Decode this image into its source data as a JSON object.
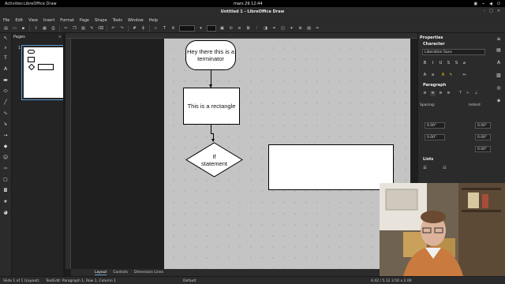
{
  "system_bar": {
    "activities": "Activities",
    "app": "LibreOffice Draw",
    "clock": "mars 29  12:44"
  },
  "window": {
    "title": "Untitled 1 - LibreOffice Draw"
  },
  "menu": [
    "File",
    "Edit",
    "View",
    "Insert",
    "Format",
    "Page",
    "Shape",
    "Tools",
    "Window",
    "Help"
  ],
  "pages_panel": {
    "title": "Pages",
    "page_number": "1"
  },
  "canvas": {
    "terminator_text": "Hey there this is a terminator",
    "rectangle_text": "This is a rectangle",
    "decision_text": "If statement"
  },
  "tabs": [
    "Layout",
    "Controls",
    "Dimension Lines"
  ],
  "status": {
    "slide": "Slide 1 of 1 (Layout)",
    "edit": "TextEdit: Paragraph 1, Row 1, Column 1",
    "layout": "Default",
    "position": "4.42 / 5.12",
    "size": "3.50 x 2.00"
  },
  "properties": {
    "title": "Properties",
    "character": "Character",
    "font": "Liberation Sans",
    "paragraph": "Paragraph",
    "spacing": "Spacing:",
    "indent": "Indent:",
    "values": [
      "0.00\"",
      "0.00\"",
      "0.00\"",
      "0.00\"",
      "0.00\""
    ],
    "lists": "Lists"
  },
  "colors": {
    "accent": "#5b9bd5",
    "page": "#c4c4c4"
  }
}
